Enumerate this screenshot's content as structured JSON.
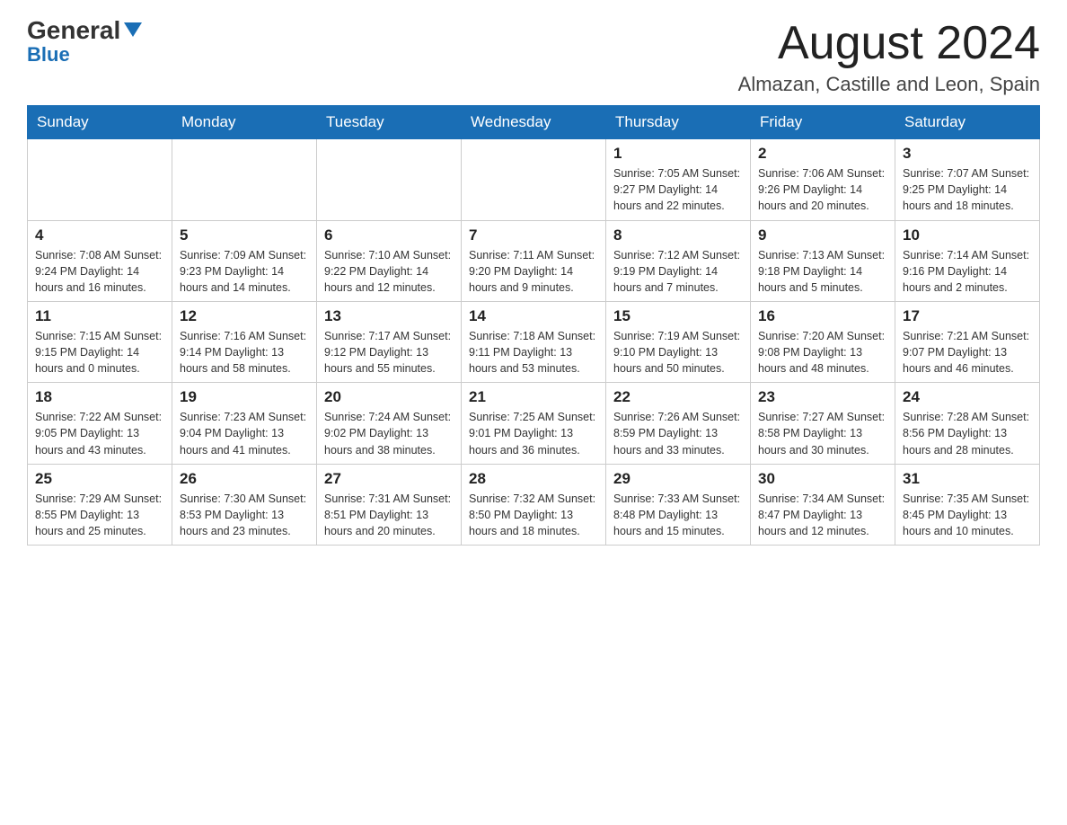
{
  "logo": {
    "general": "General",
    "blue": "Blue"
  },
  "header": {
    "month": "August 2024",
    "location": "Almazan, Castille and Leon, Spain"
  },
  "weekdays": [
    "Sunday",
    "Monday",
    "Tuesday",
    "Wednesday",
    "Thursday",
    "Friday",
    "Saturday"
  ],
  "weeks": [
    [
      {
        "day": "",
        "info": ""
      },
      {
        "day": "",
        "info": ""
      },
      {
        "day": "",
        "info": ""
      },
      {
        "day": "",
        "info": ""
      },
      {
        "day": "1",
        "info": "Sunrise: 7:05 AM\nSunset: 9:27 PM\nDaylight: 14 hours and 22 minutes."
      },
      {
        "day": "2",
        "info": "Sunrise: 7:06 AM\nSunset: 9:26 PM\nDaylight: 14 hours and 20 minutes."
      },
      {
        "day": "3",
        "info": "Sunrise: 7:07 AM\nSunset: 9:25 PM\nDaylight: 14 hours and 18 minutes."
      }
    ],
    [
      {
        "day": "4",
        "info": "Sunrise: 7:08 AM\nSunset: 9:24 PM\nDaylight: 14 hours and 16 minutes."
      },
      {
        "day": "5",
        "info": "Sunrise: 7:09 AM\nSunset: 9:23 PM\nDaylight: 14 hours and 14 minutes."
      },
      {
        "day": "6",
        "info": "Sunrise: 7:10 AM\nSunset: 9:22 PM\nDaylight: 14 hours and 12 minutes."
      },
      {
        "day": "7",
        "info": "Sunrise: 7:11 AM\nSunset: 9:20 PM\nDaylight: 14 hours and 9 minutes."
      },
      {
        "day": "8",
        "info": "Sunrise: 7:12 AM\nSunset: 9:19 PM\nDaylight: 14 hours and 7 minutes."
      },
      {
        "day": "9",
        "info": "Sunrise: 7:13 AM\nSunset: 9:18 PM\nDaylight: 14 hours and 5 minutes."
      },
      {
        "day": "10",
        "info": "Sunrise: 7:14 AM\nSunset: 9:16 PM\nDaylight: 14 hours and 2 minutes."
      }
    ],
    [
      {
        "day": "11",
        "info": "Sunrise: 7:15 AM\nSunset: 9:15 PM\nDaylight: 14 hours and 0 minutes."
      },
      {
        "day": "12",
        "info": "Sunrise: 7:16 AM\nSunset: 9:14 PM\nDaylight: 13 hours and 58 minutes."
      },
      {
        "day": "13",
        "info": "Sunrise: 7:17 AM\nSunset: 9:12 PM\nDaylight: 13 hours and 55 minutes."
      },
      {
        "day": "14",
        "info": "Sunrise: 7:18 AM\nSunset: 9:11 PM\nDaylight: 13 hours and 53 minutes."
      },
      {
        "day": "15",
        "info": "Sunrise: 7:19 AM\nSunset: 9:10 PM\nDaylight: 13 hours and 50 minutes."
      },
      {
        "day": "16",
        "info": "Sunrise: 7:20 AM\nSunset: 9:08 PM\nDaylight: 13 hours and 48 minutes."
      },
      {
        "day": "17",
        "info": "Sunrise: 7:21 AM\nSunset: 9:07 PM\nDaylight: 13 hours and 46 minutes."
      }
    ],
    [
      {
        "day": "18",
        "info": "Sunrise: 7:22 AM\nSunset: 9:05 PM\nDaylight: 13 hours and 43 minutes."
      },
      {
        "day": "19",
        "info": "Sunrise: 7:23 AM\nSunset: 9:04 PM\nDaylight: 13 hours and 41 minutes."
      },
      {
        "day": "20",
        "info": "Sunrise: 7:24 AM\nSunset: 9:02 PM\nDaylight: 13 hours and 38 minutes."
      },
      {
        "day": "21",
        "info": "Sunrise: 7:25 AM\nSunset: 9:01 PM\nDaylight: 13 hours and 36 minutes."
      },
      {
        "day": "22",
        "info": "Sunrise: 7:26 AM\nSunset: 8:59 PM\nDaylight: 13 hours and 33 minutes."
      },
      {
        "day": "23",
        "info": "Sunrise: 7:27 AM\nSunset: 8:58 PM\nDaylight: 13 hours and 30 minutes."
      },
      {
        "day": "24",
        "info": "Sunrise: 7:28 AM\nSunset: 8:56 PM\nDaylight: 13 hours and 28 minutes."
      }
    ],
    [
      {
        "day": "25",
        "info": "Sunrise: 7:29 AM\nSunset: 8:55 PM\nDaylight: 13 hours and 25 minutes."
      },
      {
        "day": "26",
        "info": "Sunrise: 7:30 AM\nSunset: 8:53 PM\nDaylight: 13 hours and 23 minutes."
      },
      {
        "day": "27",
        "info": "Sunrise: 7:31 AM\nSunset: 8:51 PM\nDaylight: 13 hours and 20 minutes."
      },
      {
        "day": "28",
        "info": "Sunrise: 7:32 AM\nSunset: 8:50 PM\nDaylight: 13 hours and 18 minutes."
      },
      {
        "day": "29",
        "info": "Sunrise: 7:33 AM\nSunset: 8:48 PM\nDaylight: 13 hours and 15 minutes."
      },
      {
        "day": "30",
        "info": "Sunrise: 7:34 AM\nSunset: 8:47 PM\nDaylight: 13 hours and 12 minutes."
      },
      {
        "day": "31",
        "info": "Sunrise: 7:35 AM\nSunset: 8:45 PM\nDaylight: 13 hours and 10 minutes."
      }
    ]
  ]
}
